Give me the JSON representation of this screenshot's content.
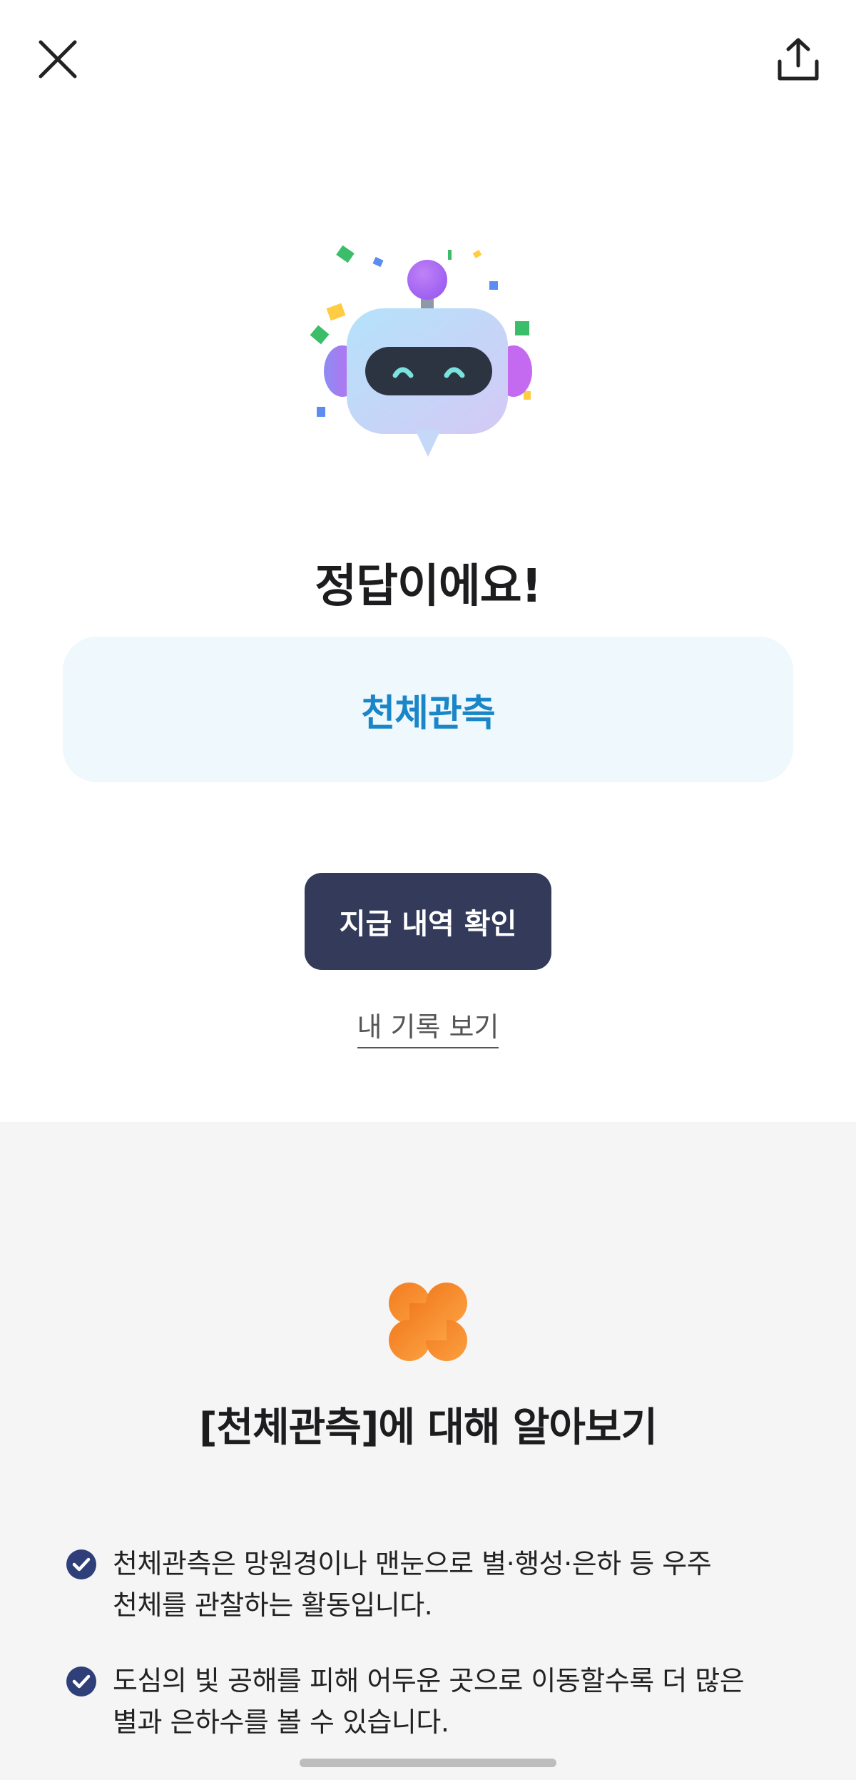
{
  "header": {
    "close_icon": "close-icon",
    "share_icon": "share-upload-icon"
  },
  "result": {
    "title": "정답이에요!",
    "answer": "천체관측"
  },
  "actions": {
    "payment_button": "지급 내역 확인",
    "record_link": "내 기록 보기"
  },
  "learn": {
    "title": "[천체관측]에 대해 알아보기",
    "facts": [
      {
        "line1": "천체관측은 망원경이나 맨눈으로 별·행성·은하 등 우주",
        "line2": "천체를 관찰하는 활동입니다."
      },
      {
        "line1": "도심의 빛 공해를 피해 어두운 곳으로 이동할수록 더 많은",
        "line2": "별과 은하수를 볼 수 있습니다."
      }
    ]
  },
  "colors": {
    "answer_bg": "#eef8fd",
    "answer_text": "#1a86c7",
    "button_bg": "#333a5a",
    "clover": "#f58a2a",
    "check": "#2f3f7a"
  }
}
